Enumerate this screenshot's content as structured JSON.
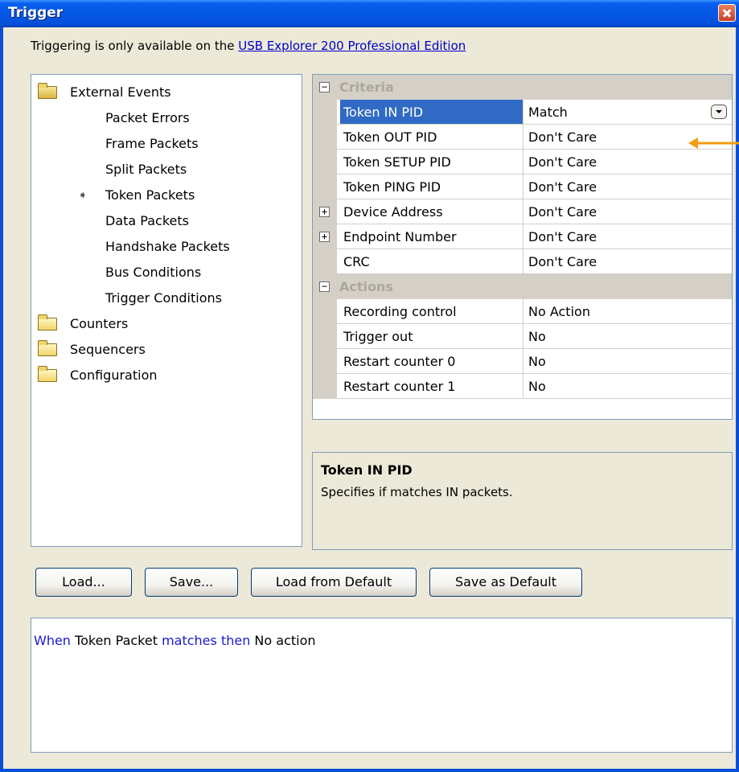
{
  "window": {
    "title": "Trigger",
    "close_icon": "close-icon"
  },
  "info": {
    "text": "Triggering is only available on the ",
    "link": "USB Explorer 200 Professional Edition"
  },
  "tree": {
    "root": {
      "label": "External Events",
      "icon": "folder-open-icon"
    },
    "children": [
      "Packet Errors",
      "Frame Packets",
      "Split Packets",
      "Token Packets",
      "Data Packets",
      "Handshake Packets",
      "Bus Conditions",
      "Trigger Conditions"
    ],
    "selected_child": "Token Packets",
    "folders": [
      "Counters",
      "Sequencers",
      "Configuration"
    ]
  },
  "grid": {
    "criteria_label": "Criteria",
    "criteria": [
      {
        "name": "Token IN PID",
        "value": "Match"
      },
      {
        "name": "Token OUT PID",
        "value": "Don't Care"
      },
      {
        "name": "Token SETUP PID",
        "value": "Don't Care"
      },
      {
        "name": "Token PING PID",
        "value": "Don't Care"
      },
      {
        "name": "Device Address",
        "value": "Don't Care"
      },
      {
        "name": "Endpoint Number",
        "value": "Don't Care"
      },
      {
        "name": "CRC",
        "value": "Don't Care"
      }
    ],
    "actions_label": "Actions",
    "actions": [
      {
        "name": "Recording control",
        "value": "No Action"
      },
      {
        "name": "Trigger out",
        "value": "No"
      },
      {
        "name": "Restart counter 0",
        "value": "No"
      },
      {
        "name": "Restart counter 1",
        "value": "No"
      }
    ]
  },
  "description": {
    "title": "Token IN PID",
    "text": "Specifies if matches IN packets."
  },
  "buttons": {
    "load": "Load...",
    "save": "Save...",
    "load_default": "Load from Default",
    "save_default": "Save as Default"
  },
  "summary": {
    "when": "When",
    "subject": " Token Packet ",
    "matches": "matches then",
    "action": " No action"
  },
  "colors": {
    "selection": "#316ac5",
    "keyword": "#1a1acc",
    "pointer": "#f39c12"
  }
}
